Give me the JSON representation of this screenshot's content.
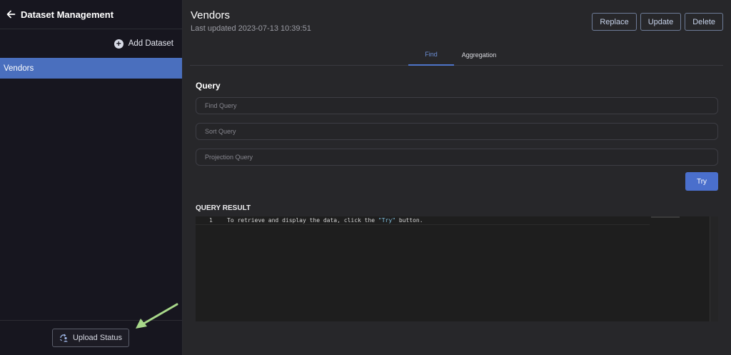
{
  "sidebar": {
    "title": "Dataset Management",
    "add_dataset_label": "Add Dataset",
    "datasets": [
      {
        "label": "Vendors",
        "selected": true
      }
    ],
    "upload_status_label": "Upload Status"
  },
  "header": {
    "title": "Vendors",
    "last_updated": "Last updated 2023-07-13 10:39:51",
    "actions": {
      "replace": "Replace",
      "update": "Update",
      "delete": "Delete"
    }
  },
  "tabs": [
    {
      "label": "Find",
      "active": true
    },
    {
      "label": "Aggregation",
      "active": false
    }
  ],
  "query": {
    "section_label": "Query",
    "find_placeholder": "Find Query",
    "sort_placeholder": "Sort Query",
    "projection_placeholder": "Projection Query",
    "try_label": "Try"
  },
  "result": {
    "section_label": "QUERY RESULT",
    "line_number": "1",
    "code_before": "To retrieve and display the data, click the ",
    "code_string": "\"Try\"",
    "code_after": " button."
  },
  "icons": {
    "back": "arrow-left-icon",
    "add": "plus-circle-icon",
    "upload_status": "upload-status-icon",
    "annotation": "annotation-arrow-icon"
  },
  "colors": {
    "accent": "#4a6fbe",
    "sidebar_bg": "#17161f",
    "main_bg": "#27272a",
    "annotation_arrow": "#a8d88a"
  }
}
